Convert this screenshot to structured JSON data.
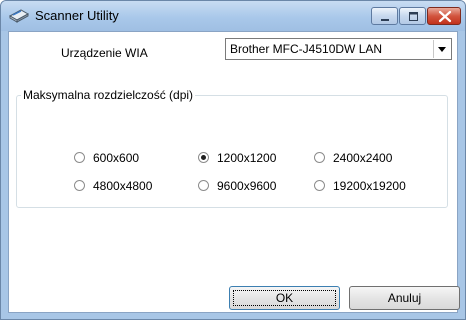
{
  "window": {
    "title": "Scanner Utility",
    "icon": "scanner-icon",
    "controls": [
      "minimize-icon",
      "maximize-icon",
      "close-icon"
    ]
  },
  "device": {
    "label": "Urządzenie WIA",
    "selected": "Brother MFC-J4510DW LAN"
  },
  "resolution": {
    "group_label": "Maksymalna rozdzielczość (dpi)",
    "options": [
      {
        "label": "600x600",
        "checked": false
      },
      {
        "label": "1200x1200",
        "checked": true
      },
      {
        "label": "2400x2400",
        "checked": false
      },
      {
        "label": "4800x4800",
        "checked": false
      },
      {
        "label": "9600x9600",
        "checked": false
      },
      {
        "label": "19200x19200",
        "checked": false
      }
    ]
  },
  "buttons": {
    "ok": "OK",
    "cancel": "Anuluj"
  }
}
